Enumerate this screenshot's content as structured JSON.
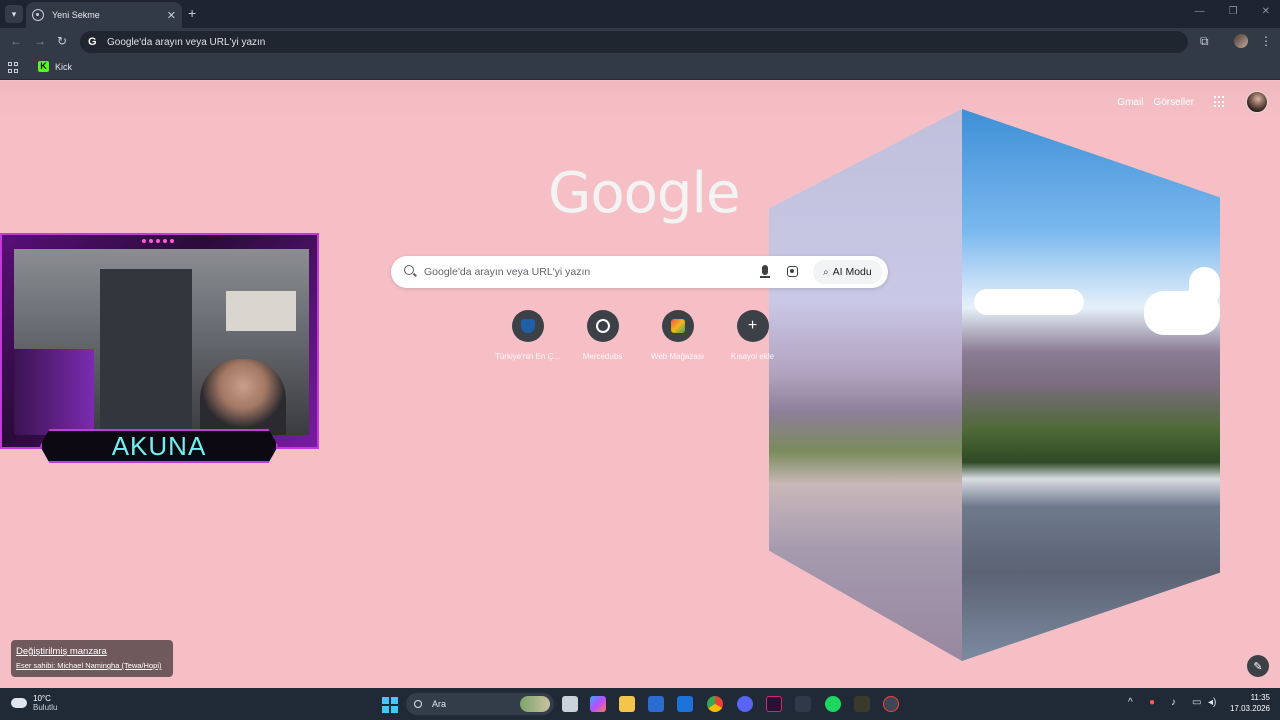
{
  "browser": {
    "tab_title": "Yeni Sekme",
    "tab_close": "✕",
    "new_tab": "+",
    "window_controls": [
      "—",
      "❐",
      "✕"
    ],
    "omnibox_text": "Google'da arayın veya URL'yi yazın",
    "omnibox_badge": "G",
    "bookmark": "Kick",
    "bookmark_logo": "K"
  },
  "page": {
    "top_links": {
      "gmail": "Gmail",
      "images": "Görseller"
    },
    "logo": "Google",
    "search_placeholder": "Google'da arayın veya URL'yi yazın",
    "ai_mode": "AI Modu",
    "shortcuts": [
      {
        "label": "Türkiye'nin En Ç...",
        "color": "#1e5fa8"
      },
      {
        "label": "Mercedubs",
        "color": "#ffffff"
      },
      {
        "label": "Web Mağazası",
        "color": "#e8584c"
      },
      {
        "label": "Kısayol ekle",
        "glyph": "+"
      }
    ],
    "credit": {
      "title": "Değiştirilmiş manzara",
      "author": "Eser sahibi: Michael Namingha (Tewa/Hopi)"
    },
    "edit_icon": "✎"
  },
  "overlay": {
    "streamer_name": "AKUNA"
  },
  "taskbar": {
    "weather_temp": "10°C",
    "weather_desc": "Bulutlu",
    "search_label": "Ara",
    "tray_chevron": "^",
    "time": "11:35",
    "date": "17.03.2026"
  }
}
